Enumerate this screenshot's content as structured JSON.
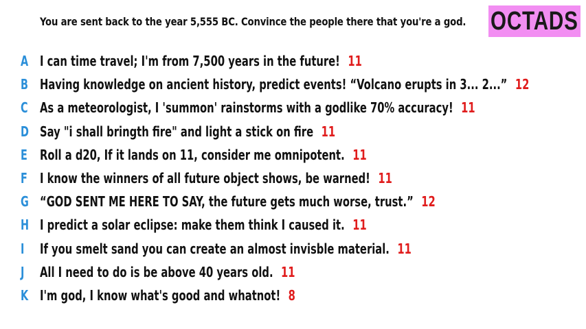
{
  "prompt": "You are sent back to the year 5,555 BC. Convince the people there that you're a god.",
  "logo": "OCTADS",
  "colors": {
    "letter": "#2b8fd9",
    "score": "#e01c1c",
    "logo_bg": "#f28ef2"
  },
  "entries": [
    {
      "letter": "A",
      "text": "I can time travel; I'm from 7,500 years in the future!",
      "score": "11"
    },
    {
      "letter": "B",
      "text": "Having knowledge on ancient history, predict events! “Volcano erupts in 3... 2...”",
      "score": "12"
    },
    {
      "letter": "C",
      "text": "As a meteorologist, I 'summon' rainstorms with a godlike 70% accuracy!",
      "score": "11"
    },
    {
      "letter": "D",
      "text": "Say \"i shall bringth fire\" and light a stick on fire",
      "score": "11"
    },
    {
      "letter": "E",
      "text": "Roll a d20, If it lands on 11, consider me omnipotent.",
      "score": "11"
    },
    {
      "letter": "F",
      "text": "I know the winners of all future object shows, be warned!",
      "score": "11"
    },
    {
      "letter": "G",
      "text": "“GOD SENT ME HERE TO SAY, the future gets much worse, trust.”",
      "score": "12"
    },
    {
      "letter": "H",
      "text": "I predict a solar eclipse: make them think I caused it.",
      "score": "11"
    },
    {
      "letter": "I",
      "text": "If you smelt sand you can create an almost invisble material.",
      "score": "11"
    },
    {
      "letter": "J",
      "text": "All I need to do is be above 40 years old.",
      "score": "11"
    },
    {
      "letter": "K",
      "text": "I'm god, I know what's good and whatnot!",
      "score": "8"
    }
  ]
}
